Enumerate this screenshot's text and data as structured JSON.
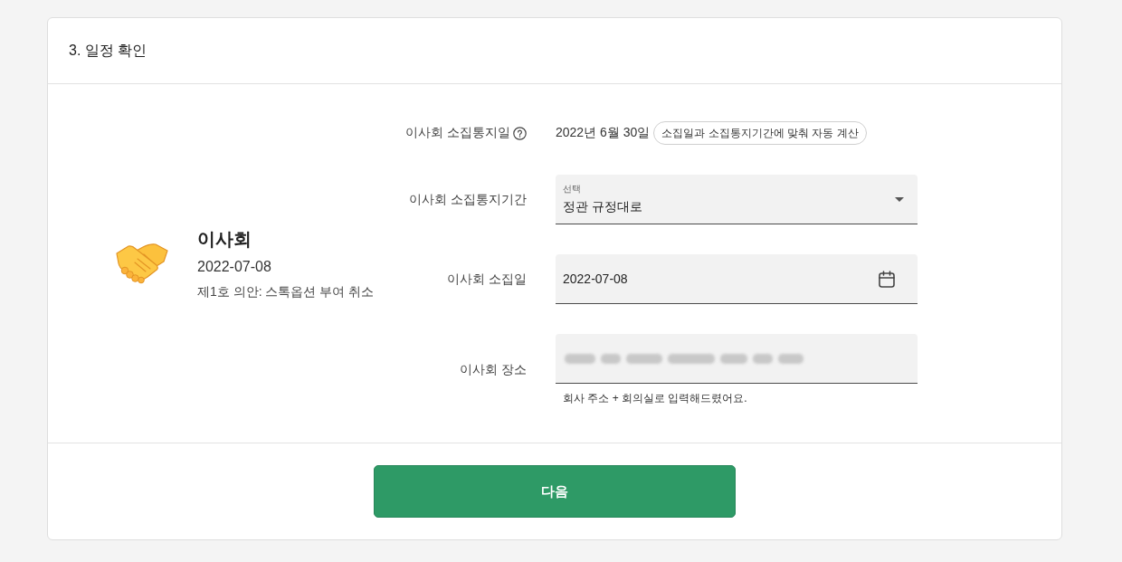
{
  "section": {
    "title": "3. 일정 확인"
  },
  "meeting": {
    "title": "이사회",
    "date": "2022-07-08",
    "agenda": "제1호 의안: 스톡옵션 부여 취소"
  },
  "form": {
    "rows": [
      {
        "kind": "text",
        "label": "이사회 소집통지일",
        "help": true,
        "value": "2022년 6월 30일",
        "chip": "소집일과 소집통지기간에 맞춰 자동 계산"
      },
      {
        "kind": "select",
        "label": "이사회 소집통지기간",
        "floating_label": "선택",
        "value": "정관 규정대로"
      },
      {
        "kind": "date",
        "label": "이사회 소집일",
        "value": "2022-07-08"
      },
      {
        "kind": "input",
        "label": "이사회 장소",
        "redacted": true,
        "helper": "회사 주소 + 회의실로 입력해드렸어요."
      }
    ]
  },
  "buttons": [
    {
      "label": "다음"
    }
  ]
}
